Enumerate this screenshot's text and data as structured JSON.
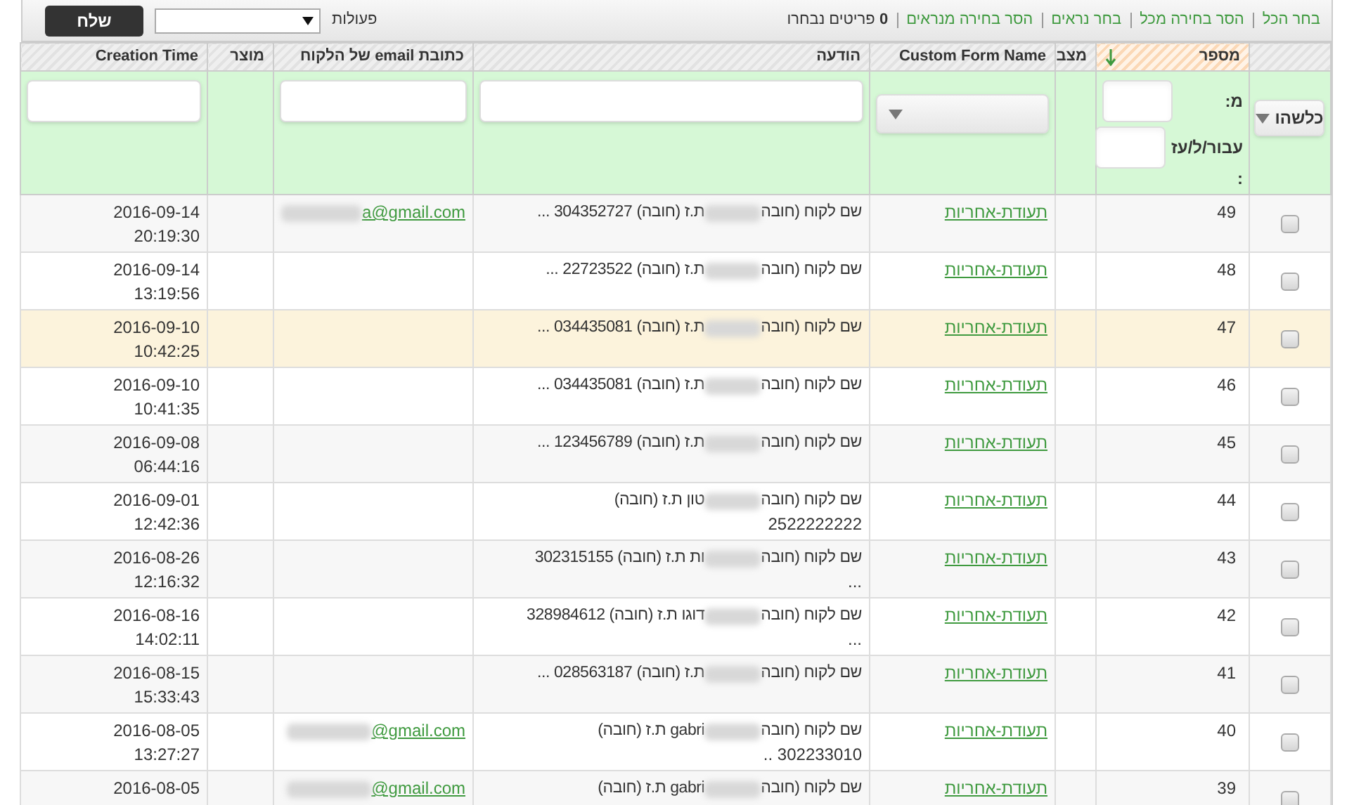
{
  "toolbar": {
    "links": [
      "בחר הכל",
      "הסר בחירה מכל",
      "בחר נראים",
      "הסר בחירה מנראים"
    ],
    "selected_count": "**0** פריטים נבחרו",
    "actions_label": "פעולות",
    "send_button": "שלח"
  },
  "columns": [
    {
      "sorted": false
    },
    {
      "label": "מספר",
      "sorted": true
    },
    {
      "label": "מצב",
      "sorted": false
    },
    {
      "label": "Custom Form Name",
      "sorted": false
    },
    {
      "label": "הודעה",
      "sorted": false
    },
    {
      "label": "כתובת email של הלקוח",
      "sorted": false
    },
    {
      "label": "מוצר",
      "sorted": false
    },
    {
      "label": "Creation Time",
      "sorted": false
    }
  ],
  "filters": {
    "any_button": "כלשהו",
    "from_label": "מ:",
    "to_label": "עבור/ל/עז :"
  },
  "rows": [
    {
      "checked": false,
      "highlighted": false,
      "number": "49",
      "form": "תעודת-אחריות",
      "message_start": "שם לקוח (חובה",
      "message_end": "ת.ז (חובה) 304352727 ...",
      "email": "a@gmail.com",
      "date": "2016-09-14",
      "time": "20:19:30"
    },
    {
      "checked": false,
      "highlighted": false,
      "number": "48",
      "form": "תעודת-אחריות",
      "message_start": "שם לקוח (חובה",
      "message_end": "ת.ז (חובה) 22723522 ...",
      "date": "2016-09-14",
      "time": "13:19:56"
    },
    {
      "checked": false,
      "highlighted": true,
      "number": "47",
      "form": "תעודת-אחריות",
      "message_start": "שם לקוח (חובה",
      "message_end": "ת.ז (חובה) 034435081 ...",
      "date": "2016-09-10",
      "time": "10:42:25"
    },
    {
      "checked": false,
      "highlighted": false,
      "number": "46",
      "form": "תעודת-אחריות",
      "message_start": "שם לקוח (חובה",
      "message_end": "ת.ז (חובה) 034435081 ...",
      "date": "2016-09-10",
      "time": "10:41:35"
    },
    {
      "checked": false,
      "highlighted": false,
      "number": "45",
      "form": "תעודת-אחריות",
      "message_start": "שם לקוח (חובה",
      "message_end": "ת.ז (חובה) 123456789 ...",
      "date": "2016-09-08",
      "time": "06:44:16"
    },
    {
      "checked": false,
      "highlighted": false,
      "number": "44",
      "form": "תעודת-אחריות",
      "message_start": "שם לקוח (חובה",
      "message_end": "טון ת.ז (חובה)",
      "message_line2": "2522222222",
      "date": "2016-09-01",
      "time": "12:42:36"
    },
    {
      "checked": false,
      "highlighted": false,
      "number": "43",
      "form": "תעודת-אחריות",
      "message_start": "שם לקוח (חובה",
      "message_end": "ות ת.ז (חובה) 302315155",
      "message_line2": "...",
      "date": "2016-08-26",
      "time": "12:16:32"
    },
    {
      "checked": false,
      "highlighted": false,
      "number": "42",
      "form": "תעודת-אחריות",
      "message_start": "שם לקוח (חובה",
      "message_end": "דוגו ת.ז (חובה) 328984612",
      "message_line2": "...",
      "date": "2016-08-16",
      "time": "14:02:11"
    },
    {
      "checked": false,
      "highlighted": false,
      "number": "41",
      "form": "תעודת-אחריות",
      "message_start": "שם לקוח (חובה",
      "message_end": "ת.ז (חובה) 028563187 ...",
      "date": "2016-08-15",
      "time": "15:33:43"
    },
    {
      "checked": false,
      "highlighted": false,
      "number": "40",
      "form": "תעודת-אחריות",
      "message_start": "שם לקוח (חובה",
      "message_end": "gabri ת.ז (חובה)",
      "message_line2": "302233010 ..",
      "email": "@gmail.com",
      "date": "2016-08-05",
      "time": "13:27:27"
    },
    {
      "checked": false,
      "highlighted": false,
      "number": "39",
      "form": "תעודת-אחריות",
      "message_start": "שם לקוח (חובה",
      "message_end": "gabri ת.ז (חובה)",
      "email": "@gmail.com",
      "date": "2016-08-05"
    }
  ]
}
